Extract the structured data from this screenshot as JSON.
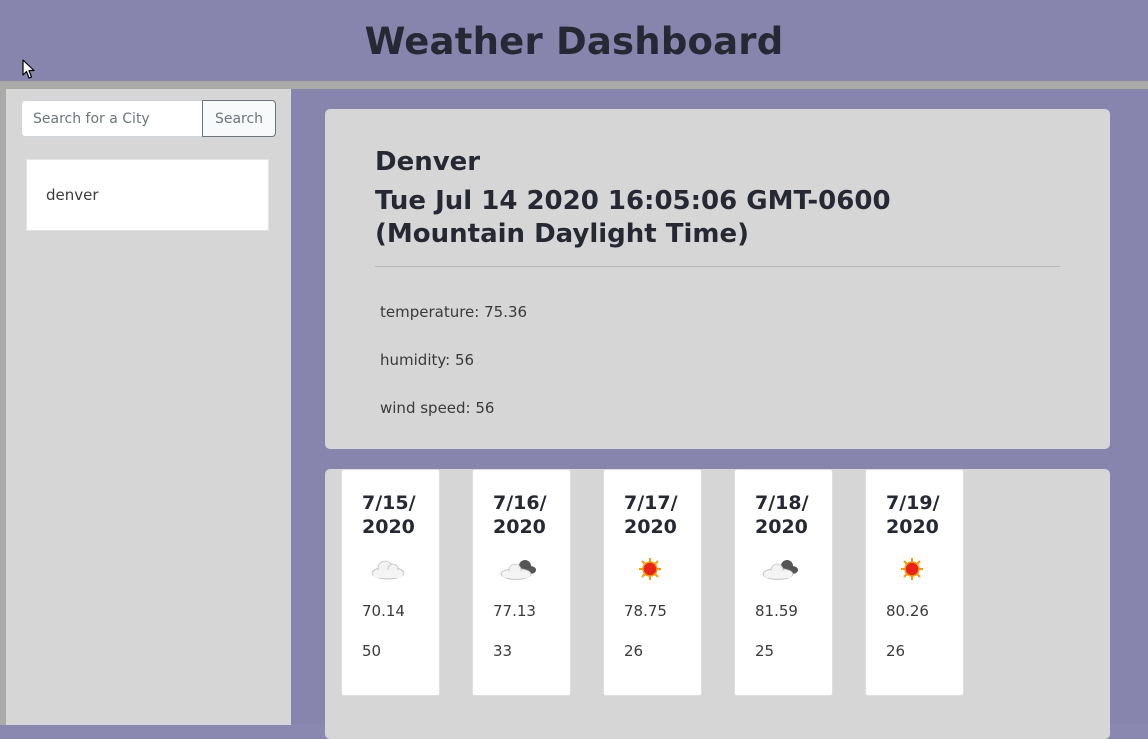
{
  "header": {
    "title": "Weather Dashboard"
  },
  "search": {
    "placeholder": "Search for a City",
    "value": "",
    "button_label": "Search"
  },
  "history": [
    "denver"
  ],
  "current": {
    "city": "Denver",
    "date": "Tue Jul 14 2020 16:05:06 GMT-0600 (Mountain Daylight Time)",
    "temperature": "temperature: 75.36",
    "humidity": "humidity: 56",
    "wind_speed": "wind speed: 56"
  },
  "forecast": [
    {
      "date": "7/15/2020",
      "icon": "cloud-icon",
      "temp": "70.14",
      "humidity": "50"
    },
    {
      "date": "7/16/2020",
      "icon": "dark-cloud-icon",
      "temp": "77.13",
      "humidity": "33"
    },
    {
      "date": "7/17/2020",
      "icon": "sun-icon",
      "temp": "78.75",
      "humidity": "26"
    },
    {
      "date": "7/18/2020",
      "icon": "dark-cloud-icon",
      "temp": "81.59",
      "humidity": "25"
    },
    {
      "date": "7/19/2020",
      "icon": "sun-icon",
      "temp": "80.26",
      "humidity": "26"
    }
  ],
  "colors": {
    "header_bg": "#8785ad",
    "panel_bg": "#d6d6d6",
    "card_bg": "#ffffff",
    "text_dark": "#262833"
  }
}
